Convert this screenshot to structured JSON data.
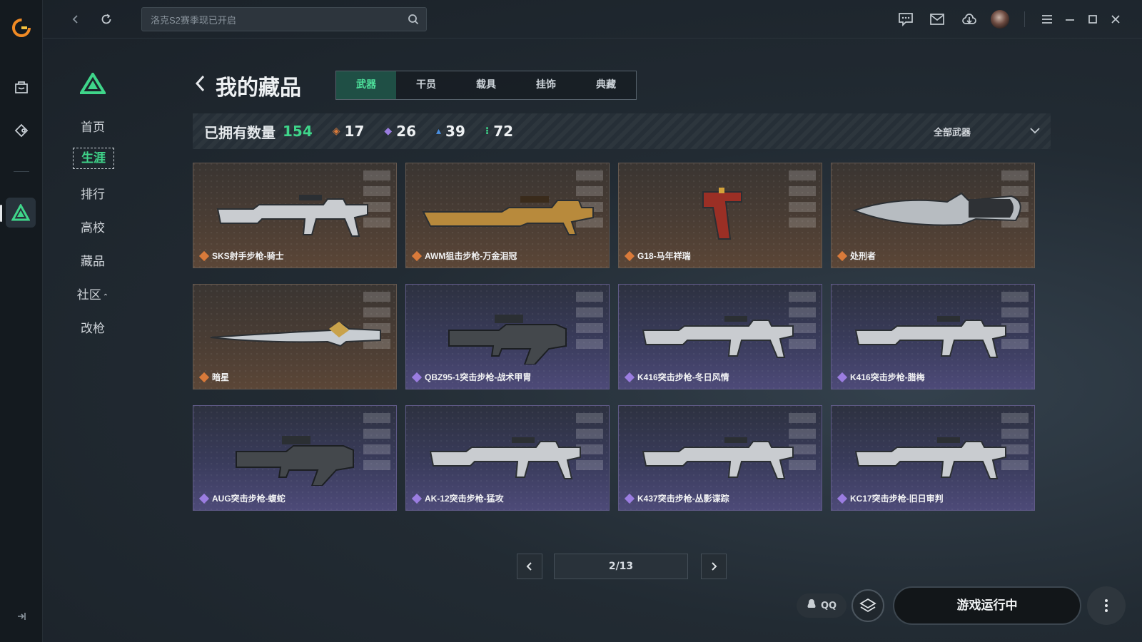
{
  "search": {
    "placeholder": "洛克S2赛季现已开启"
  },
  "menu": {
    "items": [
      {
        "label": "首页"
      },
      {
        "label": "生涯"
      },
      {
        "label": "排行"
      },
      {
        "label": "高校"
      },
      {
        "label": "藏品"
      },
      {
        "label": "社区"
      },
      {
        "label": "改枪"
      }
    ],
    "active_index": 1
  },
  "page": {
    "title": "我的藏品"
  },
  "tabs": [
    {
      "label": "武器",
      "active": true
    },
    {
      "label": "干员",
      "active": false
    },
    {
      "label": "载具",
      "active": false
    },
    {
      "label": "挂饰",
      "active": false
    },
    {
      "label": "典藏",
      "active": false
    }
  ],
  "stats": {
    "label": "已拥有数量",
    "total": "154",
    "rarity_counts": [
      {
        "value": "17",
        "color": "#d97a3a",
        "glyph": "◈"
      },
      {
        "value": "26",
        "color": "#9b7de0",
        "glyph": "◆"
      },
      {
        "value": "39",
        "color": "#4a8fe0",
        "glyph": "▴"
      },
      {
        "value": "72",
        "color": "#3fd58a",
        "glyph": "⁝"
      }
    ],
    "filter": "全部武器"
  },
  "cards": [
    {
      "name": "SKS射手步枪-骑士",
      "rarity": "orange",
      "icon": "rifle-icon"
    },
    {
      "name": "AWM狙击步枪-万金泪冠",
      "rarity": "orange",
      "icon": "sniper-icon"
    },
    {
      "name": "G18-马年祥瑞",
      "rarity": "orange",
      "icon": "pistol-icon"
    },
    {
      "name": "处刑者",
      "rarity": "orange",
      "icon": "knife-icon"
    },
    {
      "name": "暗星",
      "rarity": "orange",
      "icon": "blade-icon"
    },
    {
      "name": "QBZ95-1突击步枪-战术甲胄",
      "rarity": "purple",
      "icon": "bullpup-icon"
    },
    {
      "name": "K416突击步枪-冬日风情",
      "rarity": "purple",
      "icon": "rifle-icon"
    },
    {
      "name": "K416突击步枪-腊梅",
      "rarity": "purple",
      "icon": "rifle-icon"
    },
    {
      "name": "AUG突击步枪-蝮蛇",
      "rarity": "purple",
      "icon": "bullpup-icon"
    },
    {
      "name": "AK-12突击步枪-猛攻",
      "rarity": "purple",
      "icon": "rifle-icon"
    },
    {
      "name": "K437突击步枪-丛影谍踪",
      "rarity": "purple",
      "icon": "rifle-icon"
    },
    {
      "name": "KC17突击步枪-旧日审判",
      "rarity": "purple",
      "icon": "rifle-icon"
    }
  ],
  "pagination": {
    "label": "2/13",
    "current": 2,
    "total": 13
  },
  "bottom": {
    "qq_label": "QQ",
    "launch_label": "游戏运行中"
  }
}
